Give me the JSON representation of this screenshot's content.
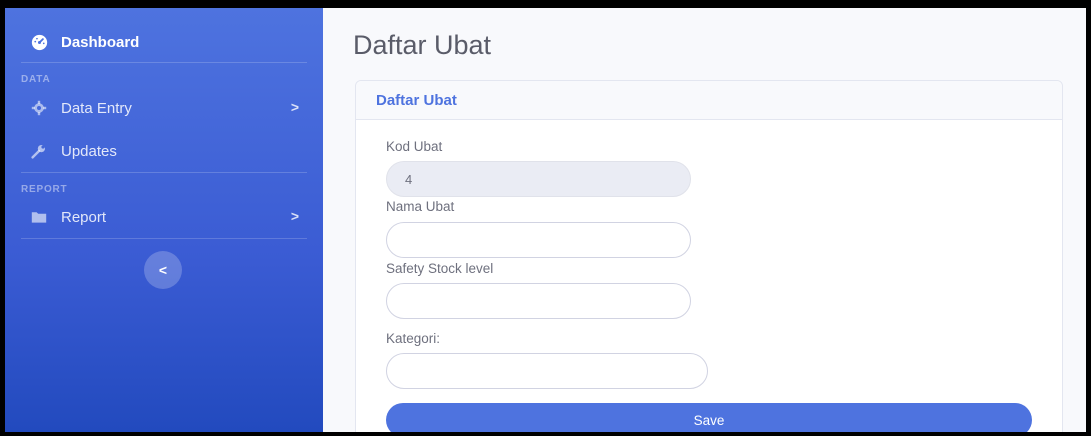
{
  "sidebar": {
    "brand": {
      "label": "Dashboard",
      "icon": "tachometer-icon"
    },
    "heading_data": "DATA",
    "data_entry": {
      "label": "Data Entry",
      "icon": "cog-icon",
      "arrow": ">"
    },
    "updates": {
      "label": "Updates",
      "icon": "wrench-icon"
    },
    "heading_report": "REPORT",
    "report": {
      "label": "Report",
      "icon": "folder-icon",
      "arrow": ">"
    },
    "toggle": "<"
  },
  "page": {
    "title": "Daftar Ubat"
  },
  "card": {
    "title": "Daftar Ubat",
    "fields": {
      "kod_ubat": {
        "label": "Kod Ubat",
        "value": "4"
      },
      "nama_ubat": {
        "label": "Nama Ubat",
        "value": ""
      },
      "safety_stock": {
        "label": "Safety Stock level",
        "value": ""
      },
      "kategori": {
        "label": "Kategori:",
        "value": ""
      }
    },
    "save_label": "Save"
  },
  "colors": {
    "primary": "#4e73df",
    "sidebar_dark": "#224abe",
    "text_muted": "#6e707e"
  }
}
